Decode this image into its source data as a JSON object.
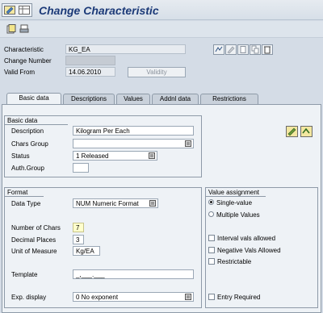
{
  "app": {
    "title": "Change Characteristic"
  },
  "header": {
    "characteristic_label": "Characteristic",
    "characteristic_value": "KG_EA",
    "change_number_label": "Change Number",
    "change_number_value": "",
    "valid_from_label": "Valid From",
    "valid_from_value": "14.06.2010",
    "validity_button": "Validity"
  },
  "tabs": [
    {
      "label": "Basic data",
      "active": true
    },
    {
      "label": "Descriptions"
    },
    {
      "label": "Values"
    },
    {
      "label": "Addnl data"
    },
    {
      "label": "Restrictions"
    }
  ],
  "basic_data": {
    "title": "Basic data",
    "description_label": "Description",
    "description_value": "Kilogram Per Each",
    "chars_group_label": "Chars Group",
    "chars_group_value": "",
    "status_label": "Status",
    "status_value": "1 Released",
    "auth_group_label": "Auth.Group",
    "auth_group_value": ""
  },
  "format": {
    "title": "Format",
    "data_type_label": "Data Type",
    "data_type_value": "NUM Numeric Format",
    "num_chars_label": "Number of Chars",
    "num_chars_value": "7",
    "decimal_places_label": "Decimal Places",
    "decimal_places_value": "3",
    "uom_label": "Unit of Measure",
    "uom_value": "Kg/EA",
    "template_label": "Template",
    "template_value": "_,___.___",
    "exp_display_label": "Exp. display",
    "exp_display_value": "0 No exponent"
  },
  "value_assignment": {
    "title": "Value assignment",
    "single_value_label": "Single-value",
    "single_value_selected": true,
    "multiple_values_label": "Multiple Values",
    "interval_label": "Interval vals allowed",
    "negative_label": "Negative Vals Allowed",
    "restrictable_label": "Restrictable",
    "entry_required_label": "Entry Required"
  },
  "colors": {
    "title": "#1c3a78",
    "background": "#d4dce6",
    "panel": "#eef2f6",
    "required_field": "#ffffcc"
  }
}
